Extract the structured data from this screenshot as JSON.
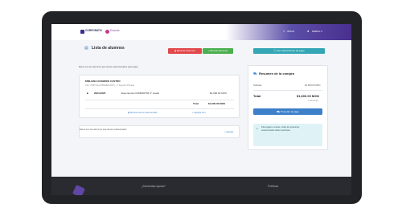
{
  "brand": {
    "name": "CORPORATIV",
    "secondary": "Escuela"
  },
  "nav": {
    "home": "INICIO",
    "profile": "PERFIL ▾"
  },
  "page": {
    "title": "Lista de alumnos",
    "remove_button": "Eliminar alumnos",
    "add_button": "Buscar alumnos",
    "cta_button": "Ver instrucciones de pago",
    "selected_label": "Estos son los alumnos que tienes seleccionados para pago:"
  },
  "student": {
    "name": "EMILIANA ACEBEDO CASTRO",
    "meta": "COL. TORTUGA (PRUEBAS RLP) · 1° Segundo Primaria",
    "period": "2024-2025",
    "concept": "Experiencia COMPARTIR 3° Grado",
    "amount": "$1,600.00 MXN",
    "total_label": "Total",
    "total_amount": "$1,600.00 MXN",
    "action_remove": "Eliminar alumno seleccionado",
    "action_add": "Agregar otro"
  },
  "related": {
    "label": "Estos son los alumnos que tienes relacionados:",
    "action": "Agregar"
  },
  "summary": {
    "title": "Resumen de la compra",
    "subtotal_label": "Subtotal",
    "subtotal_value": "$1,600.00 MXN",
    "total_label": "Total",
    "total_value": "$1,600.00 MXN",
    "count": "1 alumno(s)",
    "pay_button": "Proceder al pago",
    "info_text": "Para pagar a meses, todos los productos seleccionados deben participar."
  },
  "footer": {
    "help": "¿Necesitas ayuda?",
    "policies": "Políticas"
  },
  "colors": {
    "primary": "#3d7fc9",
    "danger": "#e2474c",
    "success": "#4caf50",
    "teal": "#34a6b5",
    "info_bg": "#dff3f6"
  }
}
